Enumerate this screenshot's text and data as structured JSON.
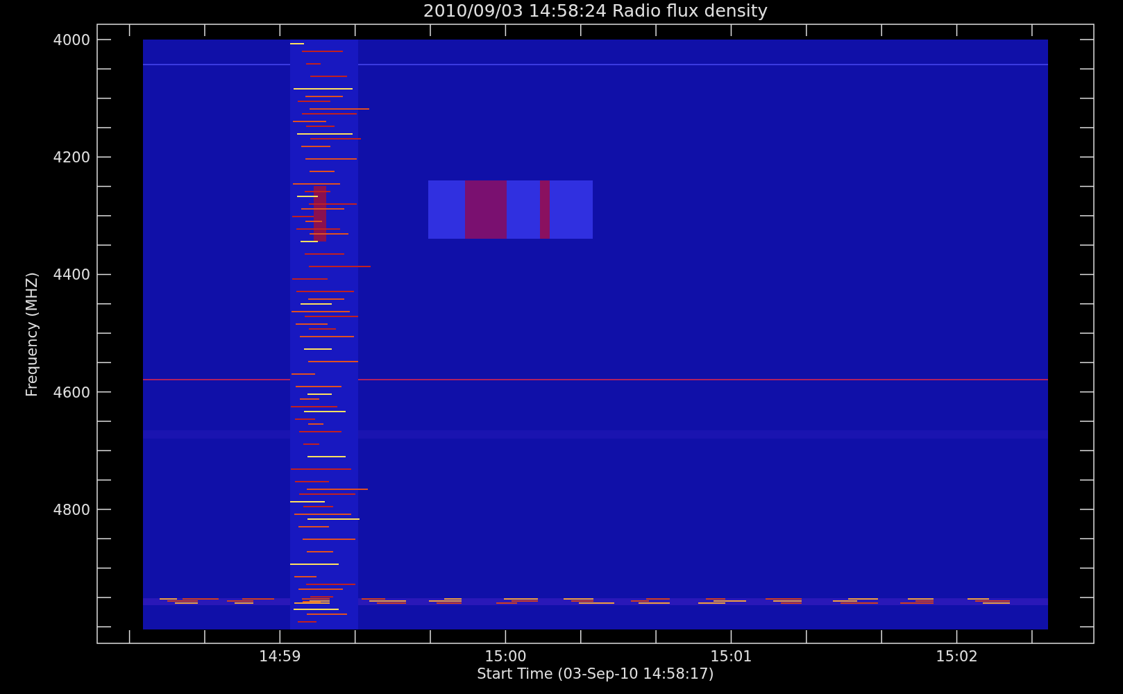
{
  "plot": {
    "title": "2010/09/03 14:58:24 Radio flux density",
    "xlabel": "Start Time (03-Sep-10 14:58:17)",
    "ylabel": "Frequency (MHZ)",
    "y_tick_labels": [
      "4000",
      "4200",
      "4400",
      "4600",
      "4800"
    ],
    "x_tick_labels": [
      "14:59",
      "15:00",
      "15:01",
      "15:02"
    ]
  }
}
